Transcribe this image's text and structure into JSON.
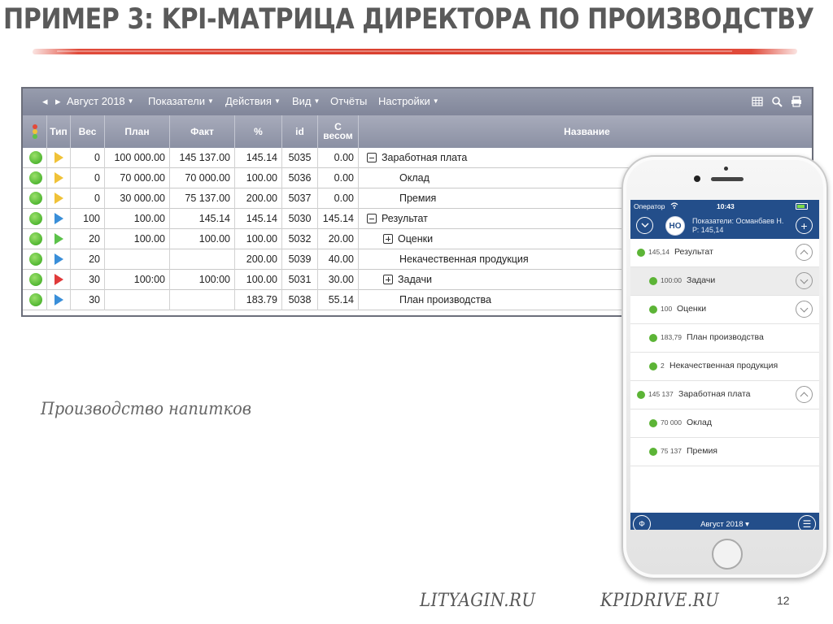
{
  "slide": {
    "title": "ПРИМЕР 3: KPI-МАТРИЦА ДИРЕКТОРА ПО ПРОИЗВОДСТВУ",
    "caption": "Производство напитков",
    "footer_left": "LITYAGIN.RU",
    "footer_right": "KPIDRIVE.RU",
    "page_number": "12",
    "accent_color": "#e04a3a"
  },
  "toolbar": {
    "prev": "◂",
    "next": "▸",
    "period": "Август 2018",
    "menu": [
      "Показатели",
      "Действия",
      "Вид",
      "Отчёты",
      "Настройки"
    ],
    "icons": [
      "grid-icon",
      "search-icon",
      "print-icon"
    ]
  },
  "table": {
    "headers": [
      "",
      "Тип",
      "Вес",
      "План",
      "Факт",
      "%",
      "id",
      "С весом",
      "Название"
    ],
    "rows": [
      {
        "type_color": "#f0c238",
        "weight": "0",
        "plan": "100 000.00",
        "fact": "145 137.00",
        "pct": "145.14",
        "id": "5035",
        "weighted": "0.00",
        "toggle": "minus",
        "indent": 0,
        "name": "Заработная плата"
      },
      {
        "type_color": "#f0c238",
        "weight": "0",
        "plan": "70 000.00",
        "fact": "70 000.00",
        "pct": "100.00",
        "id": "5036",
        "weighted": "0.00",
        "toggle": "",
        "indent": 2,
        "name": "Оклад"
      },
      {
        "type_color": "#f0c238",
        "weight": "0",
        "plan": "30 000.00",
        "fact": "75 137.00",
        "pct": "200.00",
        "id": "5037",
        "weighted": "0.00",
        "toggle": "",
        "indent": 2,
        "name": "Премия"
      },
      {
        "type_color": "#3a8fd9",
        "weight": "100",
        "plan": "100.00",
        "fact": "145.14",
        "pct": "145.14",
        "id": "5030",
        "weighted": "145.14",
        "toggle": "minus",
        "indent": 0,
        "name": "Результат"
      },
      {
        "type_color": "#5cc24a",
        "weight": "20",
        "plan": "100.00",
        "fact": "100.00",
        "pct": "100.00",
        "id": "5032",
        "weighted": "20.00",
        "toggle": "plus",
        "indent": 1,
        "name": "Оценки"
      },
      {
        "type_color": "#3a8fd9",
        "weight": "20",
        "plan": "",
        "fact": "",
        "pct": "200.00",
        "id": "5039",
        "weighted": "40.00",
        "toggle": "",
        "indent": 2,
        "name": "Некачественная продукция"
      },
      {
        "type_color": "#e03a3a",
        "weight": "30",
        "plan": "100:00",
        "fact": "100:00",
        "pct": "100.00",
        "id": "5031",
        "weighted": "30.00",
        "toggle": "plus",
        "indent": 1,
        "name": "Задачи"
      },
      {
        "type_color": "#3a8fd9",
        "weight": "30",
        "plan": "",
        "fact": "",
        "pct": "183.79",
        "id": "5038",
        "weighted": "55.14",
        "toggle": "",
        "indent": 2,
        "name": "План производства"
      }
    ]
  },
  "phone": {
    "carrier": "Оператор",
    "time": "10:43",
    "avatar_initials": "НО",
    "user_line1": "Показатели: Османбаев Н.",
    "user_line2": "Р: 145,14",
    "add_symbol": "+",
    "items": [
      {
        "value": "145,14",
        "name": "Результат",
        "level": 0,
        "chevron": "up",
        "selected": false
      },
      {
        "value": "100:00",
        "name": "Задачи",
        "level": 1,
        "chevron": "down",
        "selected": true
      },
      {
        "value": "100",
        "name": "Оценки",
        "level": 1,
        "chevron": "down",
        "selected": false
      },
      {
        "value": "183,79",
        "name": "План производства",
        "level": 1,
        "chevron": "",
        "selected": false
      },
      {
        "value": "2",
        "name": "Некачественная продукция",
        "level": 1,
        "chevron": "",
        "selected": false
      },
      {
        "value": "145 137",
        "name": "Заработная плата",
        "level": 0,
        "chevron": "up",
        "selected": false
      },
      {
        "value": "70 000",
        "name": "Оклад",
        "level": 1,
        "chevron": "",
        "selected": false
      },
      {
        "value": "75 137",
        "name": "Премия",
        "level": 1,
        "chevron": "",
        "selected": false
      }
    ],
    "bottom_period": "Август 2018 ▾",
    "filter_symbol": "Ф",
    "menu_symbol": "☰",
    "brand_color": "#234e8a"
  }
}
